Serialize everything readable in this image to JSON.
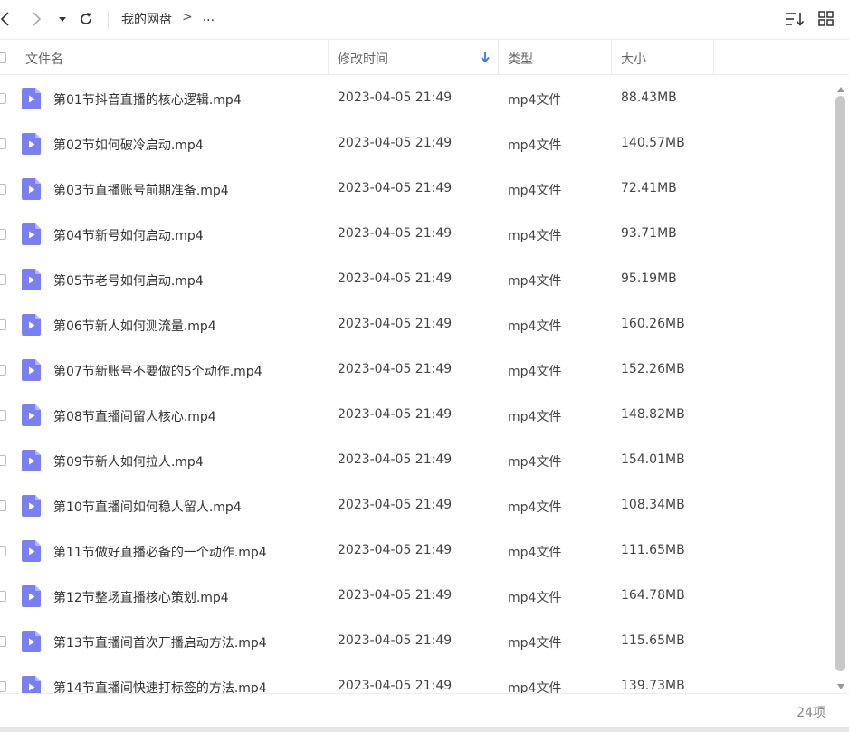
{
  "toolbar": {
    "breadcrumb": {
      "root": "我的网盘",
      "separator": ">",
      "ellipsis": "..."
    },
    "icons": [
      "chevron-left-icon",
      "chevron-right-icon",
      "caret-down-icon",
      "refresh-icon",
      "sort-icon",
      "grid-view-icon"
    ]
  },
  "table": {
    "columns": {
      "name": "文件名",
      "mtime": "修改时间",
      "type": "类型",
      "size": "大小"
    },
    "sort_column": "mtime",
    "sort_direction": "descending",
    "rows": [
      {
        "name": "第01节抖音直播的核心逻辑.mp4",
        "mtime": "2023-04-05 21:49",
        "type": "mp4文件",
        "size": "88.43MB"
      },
      {
        "name": "第02节如何破冷启动.mp4",
        "mtime": "2023-04-05 21:49",
        "type": "mp4文件",
        "size": "140.57MB"
      },
      {
        "name": "第03节直播账号前期准备.mp4",
        "mtime": "2023-04-05 21:49",
        "type": "mp4文件",
        "size": "72.41MB"
      },
      {
        "name": "第04节新号如何启动.mp4",
        "mtime": "2023-04-05 21:49",
        "type": "mp4文件",
        "size": "93.71MB"
      },
      {
        "name": "第05节老号如何启动.mp4",
        "mtime": "2023-04-05 21:49",
        "type": "mp4文件",
        "size": "95.19MB"
      },
      {
        "name": "第06节新人如何测流量.mp4",
        "mtime": "2023-04-05 21:49",
        "type": "mp4文件",
        "size": "160.26MB"
      },
      {
        "name": "第07节新账号不要做的5个动作.mp4",
        "mtime": "2023-04-05 21:49",
        "type": "mp4文件",
        "size": "152.26MB"
      },
      {
        "name": "第08节直播间留人核心.mp4",
        "mtime": "2023-04-05 21:49",
        "type": "mp4文件",
        "size": "148.82MB"
      },
      {
        "name": "第09节新人如何拉人.mp4",
        "mtime": "2023-04-05 21:49",
        "type": "mp4文件",
        "size": "154.01MB"
      },
      {
        "name": "第10节直播间如何稳人留人.mp4",
        "mtime": "2023-04-05 21:49",
        "type": "mp4文件",
        "size": "108.34MB"
      },
      {
        "name": "第11节做好直播必备的一个动作.mp4",
        "mtime": "2023-04-05 21:49",
        "type": "mp4文件",
        "size": "111.65MB"
      },
      {
        "name": "第12节整场直播核心策划.mp4",
        "mtime": "2023-04-05 21:49",
        "type": "mp4文件",
        "size": "164.78MB"
      },
      {
        "name": "第13节直播间首次开播启动方法.mp4",
        "mtime": "2023-04-05 21:49",
        "type": "mp4文件",
        "size": "115.65MB"
      },
      {
        "name": "第14节直播间快速打标签的方法.mp4",
        "mtime": "2023-04-05 21:49",
        "type": "mp4文件",
        "size": "139.73MB"
      }
    ]
  },
  "footer": {
    "item_count": "24项"
  },
  "colors": {
    "file_icon": "#7b7ff0",
    "file_icon_fold": "#b5b8f7",
    "sort_arrow": "#2f7cf6",
    "scroll_thumb": "#c8c8c8",
    "border": "#ececec"
  }
}
